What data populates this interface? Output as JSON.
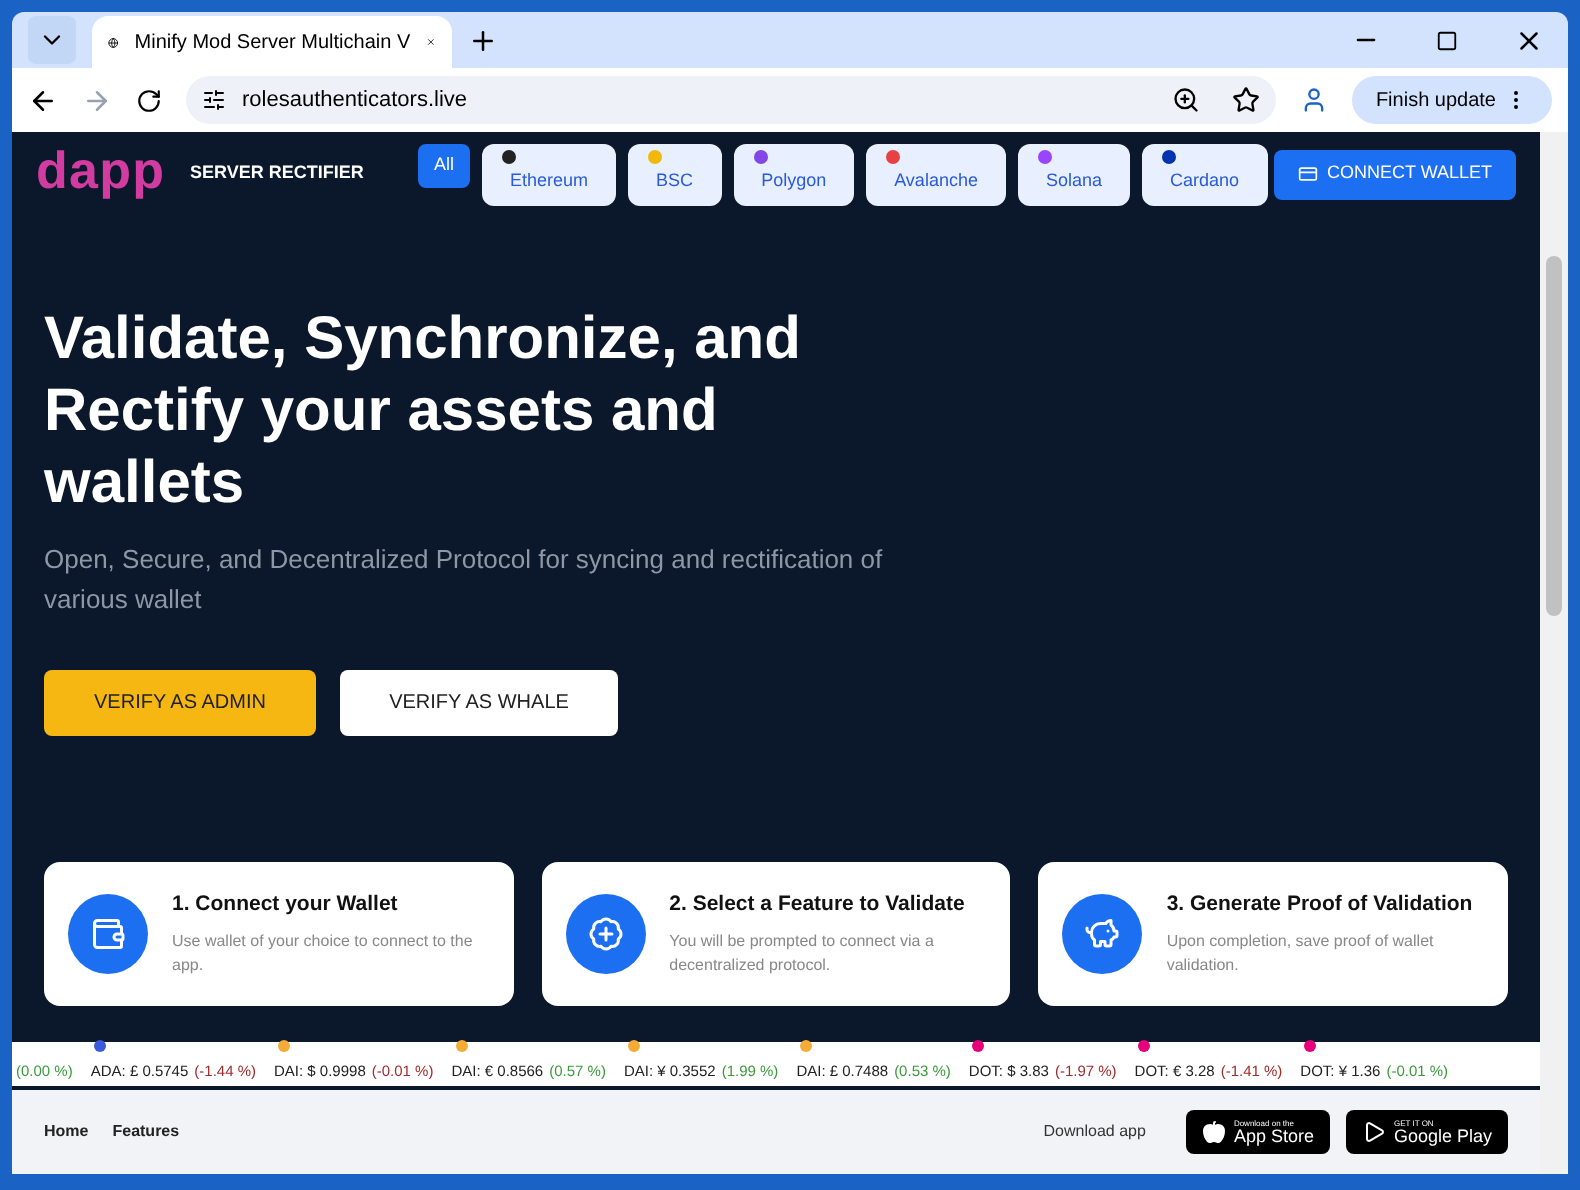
{
  "browser": {
    "tab_title": "Minify Mod Server Multichain V",
    "url": "rolesauthenticators.live",
    "update_button": "Finish update"
  },
  "nav": {
    "logo": "dapp",
    "brand": "SERVER RECTIFIER",
    "chains": [
      {
        "label": "All",
        "selected": true
      },
      {
        "label": "Ethereum",
        "selected": false,
        "color": "#222222"
      },
      {
        "label": "BSC",
        "selected": false,
        "color": "#f0b90b"
      },
      {
        "label": "Polygon",
        "selected": false,
        "color": "#8247e5"
      },
      {
        "label": "Avalanche",
        "selected": false,
        "color": "#e84142"
      },
      {
        "label": "Solana",
        "selected": false,
        "color": "#9945ff"
      },
      {
        "label": "Cardano",
        "selected": false,
        "color": "#0033ad"
      }
    ],
    "connect_button": "CONNECT WALLET"
  },
  "hero": {
    "title": "Validate, Synchronize, and Rectify your assets and wallets",
    "subtitle": "Open, Secure, and Decentralized Protocol for syncing and rectification of various wallet",
    "buttons": [
      {
        "label": "VERIFY AS ADMIN",
        "kind": "primary"
      },
      {
        "label": "VERIFY AS WHALE",
        "kind": "secondary"
      }
    ]
  },
  "steps": [
    {
      "title": "1. Connect your Wallet",
      "text": "Use wallet of your choice to connect to the app.",
      "kind": "wallet"
    },
    {
      "title": "2. Select a Feature to Validate",
      "text": "You will be prompted to connect via a decentralized protocol.",
      "kind": "badge"
    },
    {
      "title": "3. Generate Proof of Validation",
      "text": "Upon completion, save proof of wallet validation.",
      "kind": "piggy"
    }
  ],
  "ticker": [
    {
      "change": "(0.00 %)",
      "kind": "up"
    },
    {
      "price": "ADA: £ 0.5745",
      "change": "(-1.44 %)",
      "kind": "down",
      "color": "#3b5bdb"
    },
    {
      "price": "DAI: $ 0.9998",
      "change": "(-0.01 %)",
      "kind": "down",
      "color": "#f5ac37"
    },
    {
      "price": "DAI: € 0.8566",
      "change": "(0.57 %)",
      "kind": "up",
      "color": "#f5ac37"
    },
    {
      "price": "DAI: ¥ 0.3552",
      "change": "(1.99 %)",
      "kind": "up",
      "color": "#f5ac37"
    },
    {
      "price": "DAI: £ 0.7488",
      "change": "(0.53 %)",
      "kind": "up",
      "color": "#f5ac37"
    },
    {
      "price": "DOT: $ 3.83",
      "change": "(-1.97 %)",
      "kind": "down",
      "color": "#e6007a"
    },
    {
      "price": "DOT: € 3.28",
      "change": "(-1.41 %)",
      "kind": "down",
      "color": "#e6007a"
    },
    {
      "price": "DOT: ¥ 1.36",
      "change": "(-0.01 %)",
      "kind": "up",
      "color": "#e6007a"
    }
  ],
  "footer": {
    "links": [
      "Home",
      "Features"
    ],
    "download_label": "Download app",
    "stores": [
      {
        "small": "Download on the",
        "big": "App Store",
        "kind": "apple"
      },
      {
        "small": "GET IT ON",
        "big": "Google Play",
        "kind": "google"
      }
    ]
  }
}
